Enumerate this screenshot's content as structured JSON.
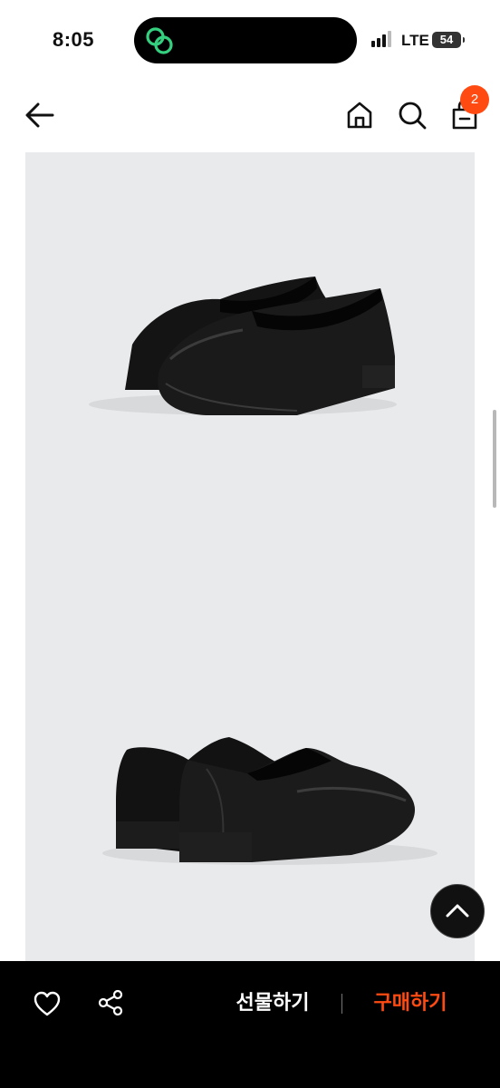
{
  "status_bar": {
    "time": "8:05",
    "carrier": "LTE",
    "battery": "54",
    "island_icon": "link-rings-icon"
  },
  "header": {
    "back_icon": "arrow-left-icon",
    "home_icon": "home-icon",
    "search_icon": "search-icon",
    "cart_icon": "shopping-bag-icon",
    "cart_count": "2"
  },
  "product_images": [
    {
      "name": "loafer-pair-front-view"
    },
    {
      "name": "loafer-pair-back-view"
    }
  ],
  "scroll_top_icon": "chevron-up-icon",
  "bottom_bar": {
    "wishlist_icon": "heart-icon",
    "share_icon": "share-icon",
    "gift_label": "선물하기",
    "buy_label": "구매하기"
  },
  "colors": {
    "accent": "#ff4b12",
    "bottom_bar": "#000000",
    "image_background": "#e9eaec"
  }
}
